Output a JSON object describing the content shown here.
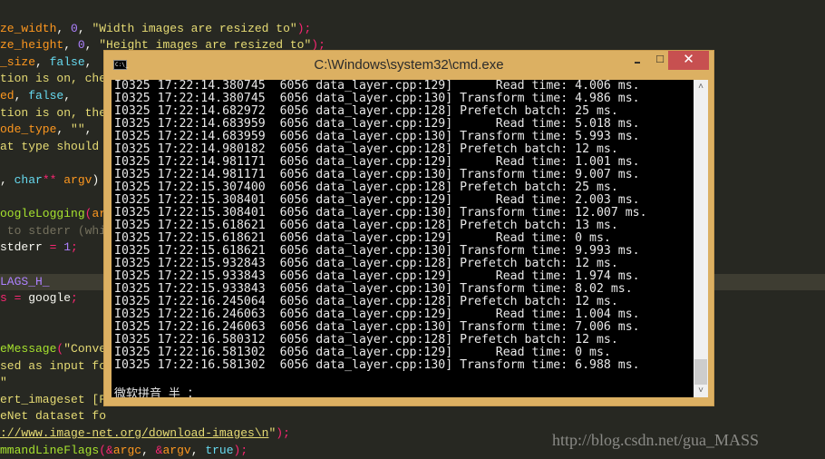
{
  "editor": {
    "lines": [
      {
        "row": 1,
        "tokens": [
          {
            "t": "ze_width",
            "c": "orange"
          },
          {
            "t": ", ",
            "c": "white"
          },
          {
            "t": "0",
            "c": "purple"
          },
          {
            "t": ", ",
            "c": "white"
          },
          {
            "t": "\"Width images are resized to\"",
            "c": "yellow"
          },
          {
            "t": ");",
            "c": "pink"
          }
        ]
      },
      {
        "row": 2,
        "tokens": [
          {
            "t": "ze_height",
            "c": "orange"
          },
          {
            "t": ", ",
            "c": "white"
          },
          {
            "t": "0",
            "c": "purple"
          },
          {
            "t": ", ",
            "c": "white"
          },
          {
            "t": "\"Height images are resized to\"",
            "c": "yellow"
          },
          {
            "t": ");",
            "c": "pink"
          }
        ]
      },
      {
        "row": 3,
        "tokens": [
          {
            "t": "_size",
            "c": "orange"
          },
          {
            "t": ", ",
            "c": "white"
          },
          {
            "t": "false",
            "c": "blue"
          },
          {
            "t": ",",
            "c": "white"
          }
        ]
      },
      {
        "row": 4,
        "tokens": [
          {
            "t": "tion is on, che",
            "c": "yellow"
          }
        ]
      },
      {
        "row": 5,
        "tokens": [
          {
            "t": "ed",
            "c": "orange"
          },
          {
            "t": ", ",
            "c": "white"
          },
          {
            "t": "false",
            "c": "blue"
          },
          {
            "t": ",",
            "c": "white"
          }
        ]
      },
      {
        "row": 6,
        "tokens": [
          {
            "t": "tion is on, the",
            "c": "yellow"
          }
        ]
      },
      {
        "row": 7,
        "tokens": [
          {
            "t": "ode_type",
            "c": "orange"
          },
          {
            "t": ", ",
            "c": "white"
          },
          {
            "t": "\"\"",
            "c": "yellow"
          },
          {
            "t": ",",
            "c": "white"
          }
        ]
      },
      {
        "row": 8,
        "tokens": [
          {
            "t": "at type should",
            "c": "yellow"
          }
        ]
      },
      {
        "row": 10,
        "tokens": [
          {
            "t": ", ",
            "c": "white"
          },
          {
            "t": "char",
            "c": "blue"
          },
          {
            "t": "**",
            "c": "pink"
          },
          {
            "t": " argv",
            "c": "orange"
          },
          {
            "t": ")",
            "c": "white"
          }
        ]
      },
      {
        "row": 12,
        "tokens": [
          {
            "t": "oogleLogging",
            "c": "green"
          },
          {
            "t": "(",
            "c": "pink"
          },
          {
            "t": "ar",
            "c": "orange"
          }
        ]
      },
      {
        "row": 13,
        "tokens": [
          {
            "t": " to stderr (whi",
            "c": "gray"
          }
        ]
      },
      {
        "row": 14,
        "tokens": [
          {
            "t": "stderr ",
            "c": "white"
          },
          {
            "t": "=",
            "c": "pink"
          },
          {
            "t": " ",
            "c": "white"
          },
          {
            "t": "1",
            "c": "purple"
          },
          {
            "t": ";",
            "c": "pink"
          }
        ]
      },
      {
        "row": 16,
        "highlight": true,
        "tokens": [
          {
            "t": "LAGS_H_",
            "c": "purple"
          }
        ]
      },
      {
        "row": 17,
        "tokens": [
          {
            "t": "s ",
            "c": "pink"
          },
          {
            "t": "=",
            "c": "pink"
          },
          {
            "t": " google",
            "c": "white"
          },
          {
            "t": ";",
            "c": "pink"
          }
        ]
      },
      {
        "row": 20,
        "tokens": [
          {
            "t": "eMessage",
            "c": "green"
          },
          {
            "t": "(",
            "c": "pink"
          },
          {
            "t": "\"Conve",
            "c": "yellow"
          }
        ]
      },
      {
        "row": 21,
        "tokens": [
          {
            "t": "sed as input fo",
            "c": "yellow"
          }
        ]
      },
      {
        "row": 22,
        "tokens": [
          {
            "t": "\"",
            "c": "yellow"
          }
        ]
      },
      {
        "row": 23,
        "tokens": [
          {
            "t": "ert_imageset [F",
            "c": "yellow"
          }
        ]
      },
      {
        "row": 24,
        "tokens": [
          {
            "t": "eNet dataset fo",
            "c": "yellow"
          }
        ]
      },
      {
        "row": 25,
        "tokens": [
          {
            "t": "://www.image-net.org/download-images\\n",
            "c": "link"
          },
          {
            "t": "\"",
            "c": "yellow"
          },
          {
            "t": ");",
            "c": "pink"
          }
        ]
      },
      {
        "row": 26,
        "tokens": [
          {
            "t": "mmandLineFlags",
            "c": "green"
          },
          {
            "t": "(",
            "c": "pink"
          },
          {
            "t": "&",
            "c": "pink"
          },
          {
            "t": "argc",
            "c": "orange"
          },
          {
            "t": ", ",
            "c": "white"
          },
          {
            "t": "&",
            "c": "pink"
          },
          {
            "t": "argv",
            "c": "orange"
          },
          {
            "t": ", ",
            "c": "white"
          },
          {
            "t": "true",
            "c": "blue"
          },
          {
            "t": ");",
            "c": "pink"
          }
        ]
      }
    ]
  },
  "window": {
    "title": "C:\\Windows\\system32\\cmd.exe",
    "icon_label": "C:\\_",
    "minimize": "▄",
    "maximize": "□",
    "close": "✕",
    "scroll_up": "˄",
    "scroll_down": "˅",
    "console_lines": [
      "I0325 17:22:14.380745  6056 data_layer.cpp:129]      Read time: 4.006 ms.",
      "I0325 17:22:14.380745  6056 data_layer.cpp:130] Transform time: 4.986 ms.",
      "I0325 17:22:14.682972  6056 data_layer.cpp:128] Prefetch batch: 25 ms.",
      "I0325 17:22:14.683959  6056 data_layer.cpp:129]      Read time: 5.018 ms.",
      "I0325 17:22:14.683959  6056 data_layer.cpp:130] Transform time: 5.993 ms.",
      "I0325 17:22:14.980182  6056 data_layer.cpp:128] Prefetch batch: 12 ms.",
      "I0325 17:22:14.981171  6056 data_layer.cpp:129]      Read time: 1.001 ms.",
      "I0325 17:22:14.981171  6056 data_layer.cpp:130] Transform time: 9.007 ms.",
      "I0325 17:22:15.307400  6056 data_layer.cpp:128] Prefetch batch: 25 ms.",
      "I0325 17:22:15.308401  6056 data_layer.cpp:129]      Read time: 2.003 ms.",
      "I0325 17:22:15.308401  6056 data_layer.cpp:130] Transform time: 12.007 ms.",
      "I0325 17:22:15.618621  6056 data_layer.cpp:128] Prefetch batch: 13 ms.",
      "I0325 17:22:15.618621  6056 data_layer.cpp:129]      Read time: 0 ms.",
      "I0325 17:22:15.618621  6056 data_layer.cpp:130] Transform time: 9.993 ms.",
      "I0325 17:22:15.932843  6056 data_layer.cpp:128] Prefetch batch: 12 ms.",
      "I0325 17:22:15.933843  6056 data_layer.cpp:129]      Read time: 1.974 ms.",
      "I0325 17:22:15.933843  6056 data_layer.cpp:130] Transform time: 8.02 ms.",
      "I0325 17:22:16.245064  6056 data_layer.cpp:128] Prefetch batch: 12 ms.",
      "I0325 17:22:16.246063  6056 data_layer.cpp:129]      Read time: 1.004 ms.",
      "I0325 17:22:16.246063  6056 data_layer.cpp:130] Transform time: 7.006 ms.",
      "I0325 17:22:16.580312  6056 data_layer.cpp:128] Prefetch batch: 12 ms.",
      "I0325 17:22:16.581302  6056 data_layer.cpp:129]      Read time: 0 ms.",
      "I0325 17:22:16.581302  6056 data_layer.cpp:130] Transform time: 6.988 ms."
    ],
    "ime_status": "微软拼音 半 ："
  },
  "watermark": "http://blog.csdn.net/gua_MASS",
  "colors": {
    "editor_bg": "#272822",
    "window_frame": "#dcb062",
    "close_button": "#c75050",
    "console_bg": "#000000"
  }
}
